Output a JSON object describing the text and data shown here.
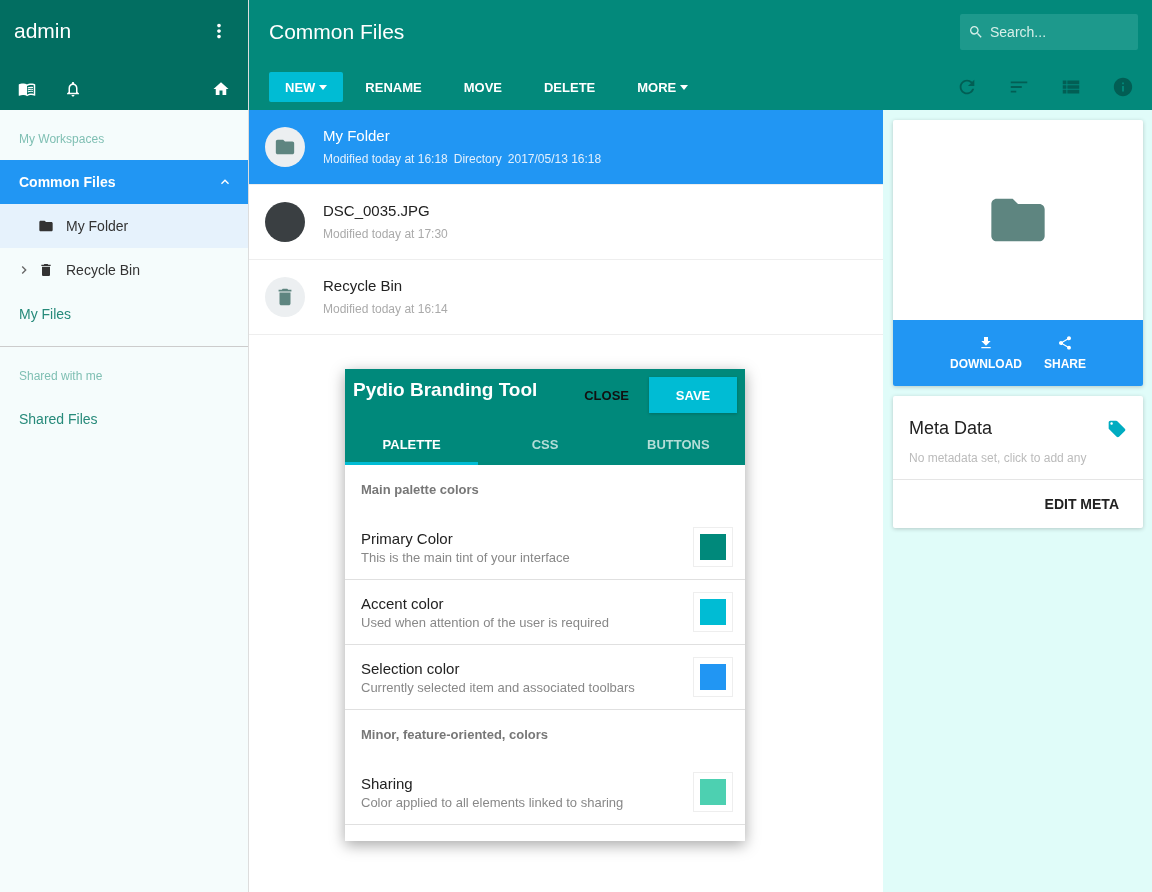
{
  "sidebar": {
    "user": "admin",
    "sections": [
      {
        "title": "My Workspaces",
        "items": [
          {
            "label": "Common Files",
            "selected": true,
            "expanded": true,
            "children": [
              {
                "label": "My Folder",
                "kind": "folder",
                "selected": true,
                "collapsible": false
              },
              {
                "label": "Recycle Bin",
                "kind": "trash",
                "selected": false,
                "collapsible": true
              }
            ]
          },
          {
            "label": "My Files",
            "selected": false,
            "expanded": false
          }
        ]
      },
      {
        "title": "Shared with me",
        "items": [
          {
            "label": "Shared Files",
            "selected": false,
            "expanded": false
          }
        ]
      }
    ]
  },
  "header": {
    "title": "Common Files",
    "search": {
      "placeholder": "Search..."
    },
    "actions": [
      {
        "label": "NEW",
        "kind": "primary",
        "dropdown": true
      },
      {
        "label": "RENAME",
        "kind": "flat",
        "dropdown": false
      },
      {
        "label": "MOVE",
        "kind": "flat",
        "dropdown": false
      },
      {
        "label": "DELETE",
        "kind": "flat",
        "dropdown": false
      },
      {
        "label": "MORE",
        "kind": "flat",
        "dropdown": true
      }
    ]
  },
  "files": [
    {
      "name": "My Folder",
      "kind": "folder",
      "selected": true,
      "details": [
        "Modified today at 16:18",
        "Directory",
        "2017/05/13 16:18"
      ]
    },
    {
      "name": "DSC_0035.JPG",
      "kind": "photo",
      "selected": false,
      "details": [
        "Modified today at 17:30"
      ]
    },
    {
      "name": "Recycle Bin",
      "kind": "trash",
      "selected": false,
      "details": [
        "Modified today at 16:14"
      ]
    }
  ],
  "preview": {
    "actions": [
      {
        "label": "DOWNLOAD",
        "kind": "download"
      },
      {
        "label": "SHARE",
        "kind": "share"
      }
    ]
  },
  "meta": {
    "title": "Meta Data",
    "empty": "No metadata set, click to add any",
    "button": "EDIT META"
  },
  "dialog": {
    "title": "Pydio Branding Tool",
    "close": "CLOSE",
    "save": "SAVE",
    "tabs": [
      {
        "label": "PALETTE",
        "selected": true
      },
      {
        "label": "CSS",
        "selected": false
      },
      {
        "label": "BUTTONS",
        "selected": false
      }
    ],
    "rows": [
      {
        "kind": "heading",
        "title": "Main palette colors"
      },
      {
        "kind": "color",
        "title": "Primary Color",
        "description": "This is the main tint of your interface",
        "color": "#00897b"
      },
      {
        "kind": "color",
        "title": "Accent color",
        "description": "Used when attention of the user is required",
        "color": "#00bcd4"
      },
      {
        "kind": "color",
        "title": "Selection color",
        "description": "Currently selected item and associated toolbars",
        "color": "#2196f3"
      },
      {
        "kind": "heading",
        "title": "Minor, feature-oriented, colors"
      },
      {
        "kind": "color",
        "title": "Sharing",
        "description": "Color applied to all elements linked to sharing",
        "color": "#4dd0b1"
      }
    ]
  }
}
